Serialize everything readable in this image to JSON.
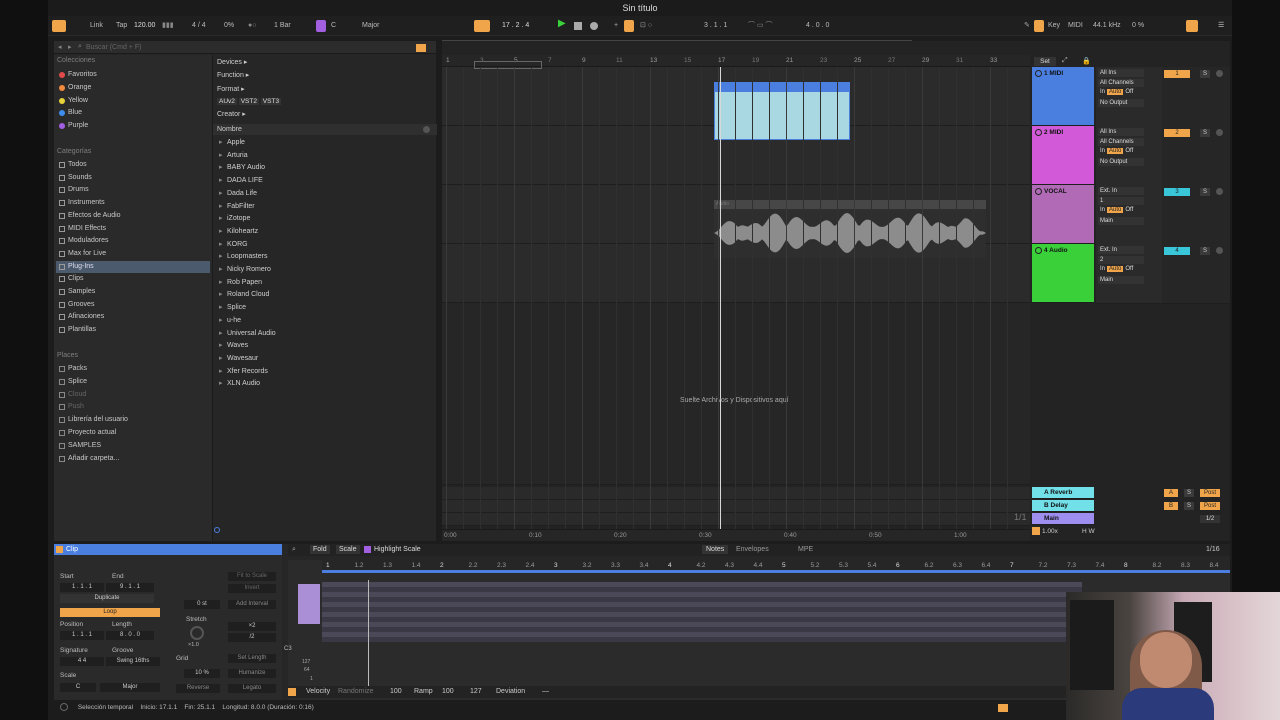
{
  "window": {
    "title": "Sin título"
  },
  "transport": {
    "link": "Link",
    "tap": "Tap",
    "tempo": "120.00",
    "meter": "4 / 4",
    "cpu_pct": "0%",
    "quant": "1 Bar",
    "key_root": "C",
    "scale": "Major",
    "position": "17 .  2 .  4",
    "loop_start": "3 .  1 .  1",
    "loop_len": "4 .  0 .  0",
    "key_btn": "Key",
    "midi_btn": "MIDI",
    "samplerate": "44.1 kHz",
    "cpu2": "0 %"
  },
  "browser": {
    "search_placeholder": "Buscar (Cmd + F)",
    "collections_header": "Colecciones",
    "collections": [
      {
        "label": "Favoritos",
        "color": "#e24b4b"
      },
      {
        "label": "Orange",
        "color": "#f08a3c"
      },
      {
        "label": "Yellow",
        "color": "#e8d23a"
      },
      {
        "label": "Blue",
        "color": "#3d8df0"
      },
      {
        "label": "Purple",
        "color": "#a25fe0"
      }
    ],
    "categories_header": "Categorías",
    "categories": [
      {
        "label": "Todos",
        "icon": "grid-icon"
      },
      {
        "label": "Sounds",
        "icon": "sound-icon"
      },
      {
        "label": "Drums",
        "icon": "drum-icon"
      },
      {
        "label": "Instruments",
        "icon": "keyboard-icon"
      },
      {
        "label": "Efectos de Audio",
        "icon": "fx-icon"
      },
      {
        "label": "MIDI Effects",
        "icon": "midi-fx-icon"
      },
      {
        "label": "Moduladores",
        "icon": "modulator-icon"
      },
      {
        "label": "Max for Live",
        "icon": "m4l-icon"
      },
      {
        "label": "Plug-Ins",
        "icon": "plugin-icon"
      },
      {
        "label": "Clips",
        "icon": "clip-icon"
      },
      {
        "label": "Samples",
        "icon": "sample-icon"
      },
      {
        "label": "Grooves",
        "icon": "groove-icon"
      },
      {
        "label": "Afinaciones",
        "icon": "tuning-icon"
      },
      {
        "label": "Plantillas",
        "icon": "template-icon"
      }
    ],
    "places_header": "Places",
    "places": [
      {
        "label": "Packs"
      },
      {
        "label": "Splice"
      },
      {
        "label": "Cloud"
      },
      {
        "label": "Push"
      },
      {
        "label": "Librería del usuario"
      },
      {
        "label": "Proyecto actual"
      },
      {
        "label": "SAMPLES"
      },
      {
        "label": "Añadir carpeta..."
      }
    ],
    "filters": {
      "devices": "Devices ▸",
      "function": "Function ▸",
      "format": "Format ▸",
      "format_tags": [
        "AUv2",
        "VST2",
        "VST3"
      ],
      "creator": "Creator ▸"
    },
    "list_header": "Nombre",
    "vendors": [
      "Apple",
      "Arturia",
      "BABY Audio",
      "DADA LIFE",
      "Dada Life",
      "FabFilter",
      "iZotope",
      "Kiloheartz",
      "KORG",
      "Loopmasters",
      "Nicky Romero",
      "Rob Papen",
      "Roland Cloud",
      "Splice",
      "u-he",
      "Universal Audio",
      "Waves",
      "Wavesaur",
      "Xfer Records",
      "XLN Audio"
    ]
  },
  "arrangement": {
    "ruler": [
      "1",
      "5",
      "9",
      "13",
      "17",
      "21",
      "25",
      "29",
      "33"
    ],
    "ruler_mid": [
      "3",
      "7",
      "11",
      "15",
      "19",
      "23",
      "27",
      "31"
    ],
    "time_ruler": [
      "0:00",
      "0:10",
      "0:20",
      "0:30",
      "0:40",
      "0:50",
      "1:00"
    ],
    "drop_hint": "Suelte Archivos y Dispositivos aquí",
    "zoom": "1/1",
    "audio_clip_label": "Audio",
    "set_btn": "Set"
  },
  "tracks": [
    {
      "name": "1 MIDI",
      "color": "#4a7fe0",
      "num": "1",
      "in1": "All Ins",
      "in2": "All Channels",
      "mon": [
        "In",
        "Auto",
        "Off"
      ],
      "out": "No Output"
    },
    {
      "name": "2 MIDI",
      "color": "#d25ad8",
      "num": "2",
      "in1": "All Ins",
      "in2": "All Channels",
      "mon": [
        "In",
        "Auto",
        "Off"
      ],
      "out": "No Output"
    },
    {
      "name": "VOCAL",
      "color": "#b06ab6",
      "num": "3",
      "in1": "Ext. In",
      "in2": "1",
      "mon": [
        "In",
        "Auto",
        "Off"
      ],
      "out": "Main"
    },
    {
      "name": "4 Audio",
      "color": "#3ad03a",
      "num": "4",
      "in1": "Ext. In",
      "in2": "2",
      "mon": [
        "In",
        "Auto",
        "Off"
      ],
      "out": "Main"
    }
  ],
  "returns": [
    {
      "name": "A Reverb",
      "letter": "A",
      "post": "Post"
    },
    {
      "name": "B Delay",
      "letter": "B",
      "post": "Post"
    },
    {
      "name": "Main",
      "letter": "",
      "post": "1/2"
    }
  ],
  "tempo_small": "1.00x",
  "clip_view": {
    "title": "Clip",
    "start": "Start",
    "end": "End",
    "set": "Set",
    "start_val": "1 .  1 .  1",
    "end_val": "9 .  1 .  1",
    "duplicate": "Duplicate",
    "loop": "Loop",
    "position": "Position",
    "length": "Length",
    "pos_val": "1 .  1 .  1",
    "len_val": "8 .  0 .  0",
    "signature": "Signature",
    "groove": "Groove",
    "sig_val": "4   4",
    "groove_val": "Swing 16ths",
    "scale": "Scale",
    "scale_root": "C",
    "scale_name": "Major",
    "fit_to_scale": "Fit to Scale",
    "invert": "Invert",
    "semitones": "0 st",
    "add_interval": "Add Interval",
    "stretch": "Stretch",
    "x2": "×2",
    "div2": "/2",
    "stretch_val": "×1.0",
    "grid": "Grid",
    "set_length": "Set Length",
    "humanize_pct": "10 %",
    "humanize": "Humanize",
    "reverse": "Reverse",
    "legato": "Legato"
  },
  "midi_editor": {
    "fold": "Fold",
    "scale": "Scale",
    "highlight": "Highlight Scale",
    "tabs": [
      "Notes",
      "Envelopes",
      "MPE"
    ],
    "grid": "1/16",
    "ruler": [
      "1",
      "1.2",
      "1.3",
      "1.4",
      "2",
      "2.2",
      "2.3",
      "2.4",
      "3",
      "3.2",
      "3.3",
      "3.4",
      "4",
      "4.2",
      "4.3",
      "4.4",
      "5",
      "5.2",
      "5.3",
      "5.4",
      "6",
      "6.2",
      "6.3",
      "6.4",
      "7",
      "7.2",
      "7.3",
      "7.4",
      "8",
      "8.2",
      "8.3",
      "8.4"
    ],
    "key_c3": "C3",
    "vel_127": "127",
    "vel_64": "64",
    "vel_1": "1",
    "velocity": "Velocity",
    "randomize": "Randomize",
    "vel_val": "100",
    "ramp": "Ramp",
    "ramp_a": "100",
    "ramp_b": "127",
    "deviation": "Deviation",
    "dev_val": "—"
  },
  "status": {
    "mode": "Selección temporal",
    "start": "Inicio: 17.1.1",
    "end": "Fin: 25.1.1",
    "length": "Longitud: 8.0.0 (Duración: 0:16)"
  }
}
